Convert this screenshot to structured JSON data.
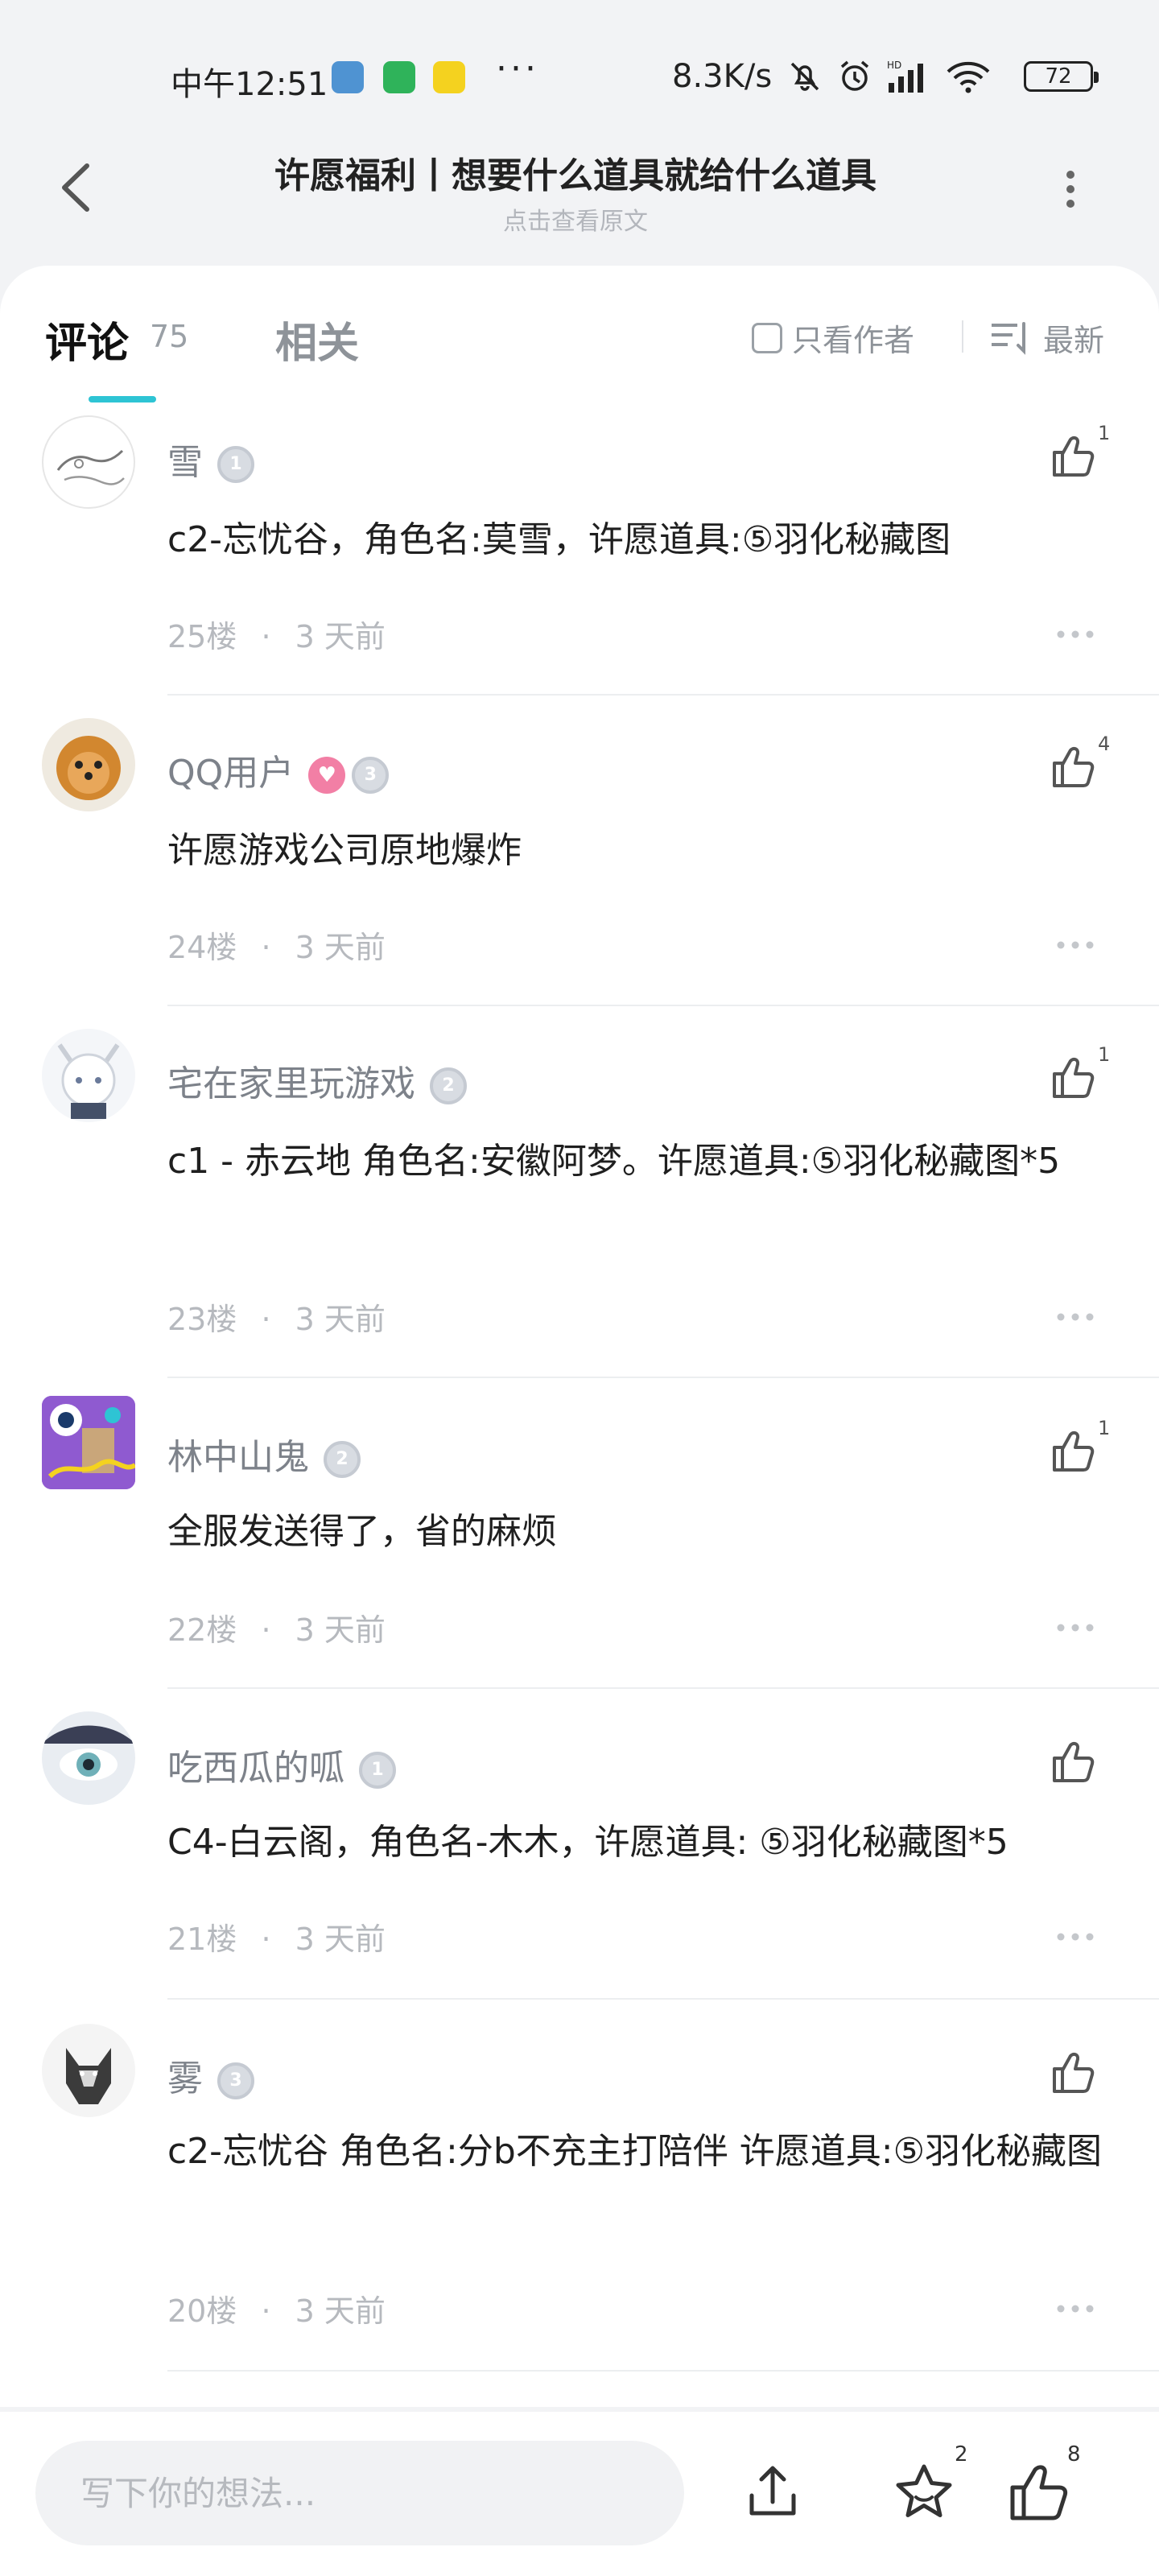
{
  "status_bar": {
    "time": "中午12:51",
    "apps": [
      "app-icon-blue",
      "app-icon-green",
      "app-icon-yellow"
    ],
    "more": "···",
    "net_speed": "8.3K/s",
    "battery": "72"
  },
  "header": {
    "title": "许愿福利丨想要什么道具就给什么道具",
    "subtitle": "点击查看原文"
  },
  "tabs": {
    "comments_label": "评论",
    "comments_count": "75",
    "related_label": "相关",
    "author_only_label": "只看作者",
    "sort_label": "最新"
  },
  "comments": [
    {
      "username": "雪",
      "badge": "1",
      "has_heart": false,
      "content": "c2-忘忧谷，角色名:莫雪，许愿道具:⑤羽化秘藏图",
      "floor": "25楼",
      "time": "3 天前",
      "likes": "1"
    },
    {
      "username": "QQ用户",
      "badge": "3",
      "has_heart": true,
      "content": "许愿游戏公司原地爆炸",
      "floor": "24楼",
      "time": "3 天前",
      "likes": "4"
    },
    {
      "username": "宅在家里玩游戏",
      "badge": "2",
      "has_heart": false,
      "content": "c1 - 赤云地 角色名:安徽阿梦。许愿道具:⑤羽化秘藏图*5",
      "floor": "23楼",
      "time": "3 天前",
      "likes": "1"
    },
    {
      "username": "林中山鬼",
      "badge": "2",
      "has_heart": false,
      "content": "全服发送得了，省的麻烦",
      "floor": "22楼",
      "time": "3 天前",
      "likes": "1"
    },
    {
      "username": "吃西瓜的呱",
      "badge": "1",
      "has_heart": false,
      "content": "C4-白云阁，角色名-木木，许愿道具: ⑤羽化秘藏图*5",
      "floor": "21楼",
      "time": "3 天前",
      "likes": ""
    },
    {
      "username": "雾",
      "badge": "3",
      "has_heart": false,
      "content": "c2-忘忧谷 角色名:分b不充主打陪伴 许愿道具:⑤羽化秘藏图",
      "floor": "20楼",
      "time": "3 天前",
      "likes": ""
    }
  ],
  "meta_separator": "·",
  "bottom_bar": {
    "input_placeholder": "写下你的想法...",
    "favorite_count": "2",
    "like_count": "8"
  },
  "colors": {
    "accent": "#2ec4d4",
    "card_bg": "#ffffff",
    "page_bg": "#f2f3f5",
    "muted_text": "#b6b9be"
  }
}
